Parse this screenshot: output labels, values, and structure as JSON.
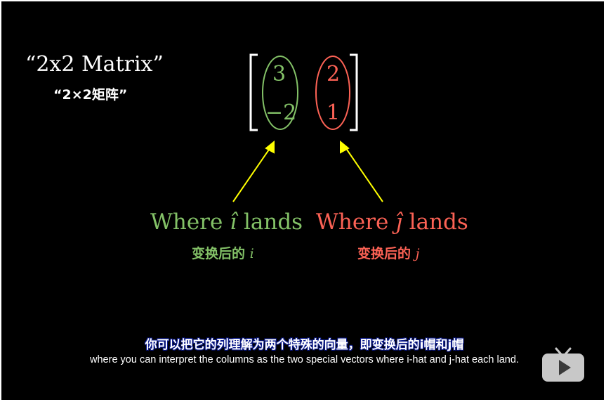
{
  "title": {
    "en": "“2x2 Matrix”",
    "zh": "“2×2矩阵”"
  },
  "matrix": {
    "column_i": [
      "3",
      "−2"
    ],
    "column_j": [
      "2",
      "1"
    ]
  },
  "labels": {
    "i_where": "Where ",
    "i_hat": "î",
    "i_lands": " lands",
    "j_where": "Where ",
    "j_hat": "ĵ",
    "j_lands": " lands",
    "i_zh": "变换后的 ",
    "i_var": "i",
    "j_zh": "变换后的 ",
    "j_var": "j"
  },
  "subtitles": {
    "zh": "你可以把它的列理解为两个特殊的向量，即变换后的i帽和j帽",
    "en": "where you can interpret the columns as the two special vectors where i-hat and j-hat each land."
  },
  "colors": {
    "green": "#83c167",
    "red": "#fc6255",
    "yellow": "#ffff00",
    "background": "#000000"
  },
  "icons": {
    "watermark": "tv-play-icon"
  }
}
